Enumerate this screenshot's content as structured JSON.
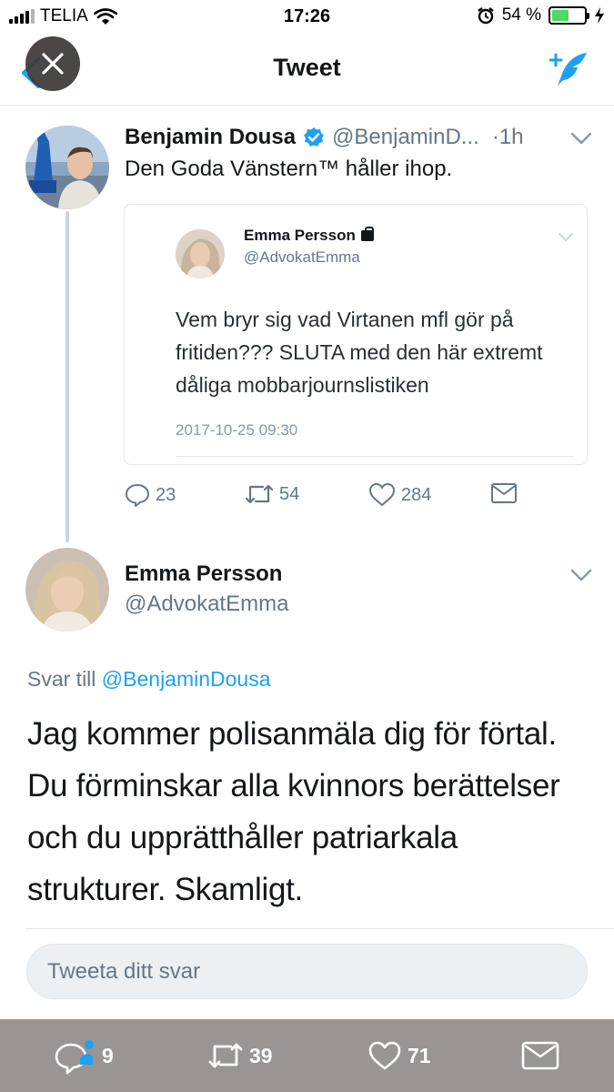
{
  "status_bar": {
    "carrier": "TELIA",
    "time": "17:26",
    "battery_percent": "54 %",
    "battery_level": 0.54
  },
  "nav": {
    "title": "Tweet"
  },
  "tweet": {
    "author_name": "Benjamin Dousa",
    "author_handle": "@BenjaminD...",
    "separator": "·",
    "time_ago": "1h",
    "text": "Den Goda Vänstern™ håller ihop.",
    "embedded_screenshot": {
      "name": "Emma Persson",
      "handle": "@AdvokatEmma",
      "body": "Vem bryr sig vad Virtanen mfl gör på fritiden??? SLUTA med den här extremt dåliga mobbarjournslistiken",
      "date": "2017-10-25 09:30"
    },
    "replies": "23",
    "retweets": "54",
    "likes": "284"
  },
  "reply": {
    "author_name": "Emma Persson",
    "author_handle": "@AdvokatEmma",
    "replying_prefix": "Svar till",
    "replying_to": "@BenjaminDousa",
    "text": "Jag kommer polisanmäla dig för förtal. Du förminskar alla kvinnors berättelser och du upprätthåller patriarkala strukturer. Skamligt."
  },
  "reply_input": {
    "placeholder": "Tweeta ditt svar"
  },
  "tab_bar": {
    "replies": "9",
    "retweets": "39",
    "likes": "71"
  },
  "colors": {
    "accent": "#1da1f2",
    "text": "#14171a",
    "muted": "#657786",
    "battery": "#4cd964",
    "bottom_bar": "#9a9593"
  },
  "icons": [
    "signal-icon",
    "wifi-icon",
    "alarm-icon",
    "battery-icon",
    "charging-icon",
    "back-icon",
    "close-icon",
    "compose-icon",
    "verified-icon",
    "chevron-down-icon",
    "lock-icon",
    "reply-icon",
    "retweet-icon",
    "like-icon",
    "message-icon"
  ]
}
